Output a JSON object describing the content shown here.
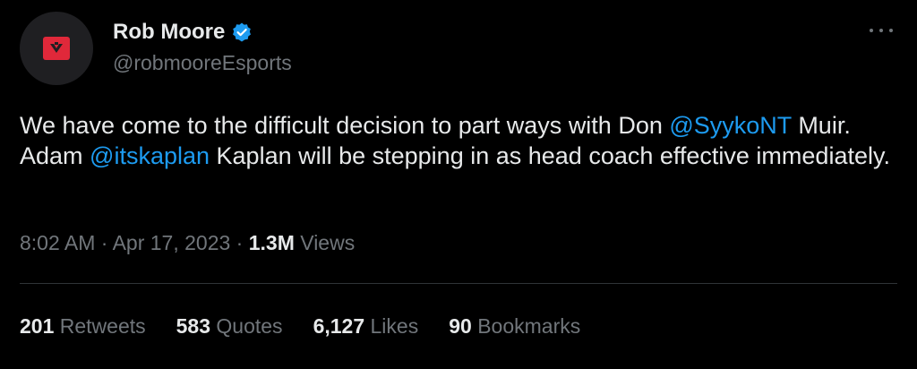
{
  "author": {
    "display_name": "Rob Moore",
    "handle": "@robmooreEsports",
    "verified": true
  },
  "tweet": {
    "text_part1": "We have come to the difficult decision to part ways with Don ",
    "mention1": "@SyykoNT",
    "text_part2": " Muir. Adam ",
    "mention2": "@itskaplan",
    "text_part3": " Kaplan will be stepping in as head coach effective immediately."
  },
  "meta": {
    "time": "8:02 AM",
    "separator1": " · ",
    "date": "Apr 17, 2023",
    "separator2": " · ",
    "views_count": "1.3M",
    "views_label": " Views"
  },
  "stats": {
    "retweets_count": "201",
    "retweets_label": " Retweets",
    "quotes_count": "583",
    "quotes_label": " Quotes",
    "likes_count": "6,127",
    "likes_label": " Likes",
    "bookmarks_count": "90",
    "bookmarks_label": " Bookmarks"
  },
  "colors": {
    "background": "#000000",
    "text": "#e7e9ea",
    "secondary": "#71767b",
    "link": "#1d9bf0",
    "verified": "#1d9bf0",
    "avatar_logo": "#e0283a"
  },
  "icons": {
    "verified": "verified-badge-icon",
    "more": "more-options-icon",
    "avatar": "team-logo-avatar"
  }
}
